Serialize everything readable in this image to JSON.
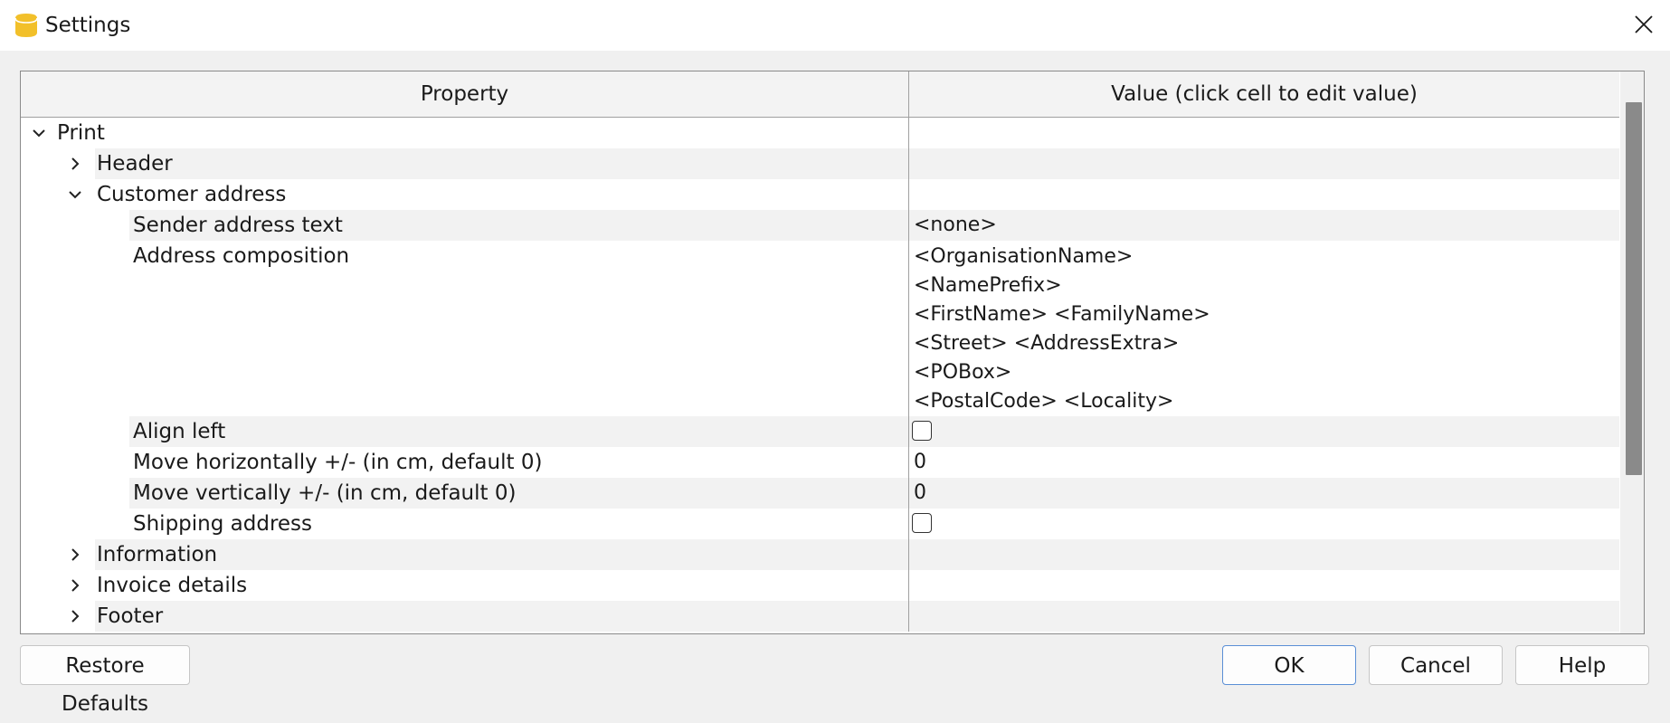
{
  "window": {
    "title": "Settings"
  },
  "table": {
    "headers": {
      "property": "Property",
      "value": "Value (click cell to edit value)"
    },
    "rows": [
      {
        "label": "Print",
        "level": 0,
        "expander": "expanded"
      },
      {
        "label": "Header",
        "level": 1,
        "expander": "collapsed"
      },
      {
        "label": "Customer address",
        "level": 1,
        "expander": "expanded"
      },
      {
        "label": "Sender address text",
        "level": 2,
        "value": "<none>"
      },
      {
        "label": "Address composition",
        "level": 2,
        "value_lines": [
          "<OrganisationName>",
          "<NamePrefix>",
          "<FirstName> <FamilyName>",
          "<Street> <AddressExtra>",
          "<POBox>",
          "<PostalCode> <Locality>"
        ]
      },
      {
        "label": "Align left",
        "level": 2,
        "checked": false
      },
      {
        "label": "Move horizontally +/- (in cm, default 0)",
        "level": 2,
        "value": "0"
      },
      {
        "label": "Move vertically +/- (in cm, default 0)",
        "level": 2,
        "value": "0"
      },
      {
        "label": "Shipping address",
        "level": 2,
        "checked": false
      },
      {
        "label": "Information",
        "level": 1,
        "expander": "collapsed"
      },
      {
        "label": "Invoice details",
        "level": 1,
        "expander": "collapsed"
      },
      {
        "label": "Footer",
        "level": 1,
        "expander": "collapsed"
      }
    ]
  },
  "buttons": {
    "restore_defaults": "Restore Defaults",
    "ok": "OK",
    "cancel": "Cancel",
    "help": "Help"
  },
  "colors": {
    "app_icon": "#f2c02a",
    "row_band": "#f2f2f2",
    "ok_border": "#5a8fd6"
  },
  "icons": {
    "app": "database-cylinder-icon",
    "close": "close-icon",
    "expanded": "chevron-down-icon",
    "collapsed": "chevron-right-icon"
  }
}
